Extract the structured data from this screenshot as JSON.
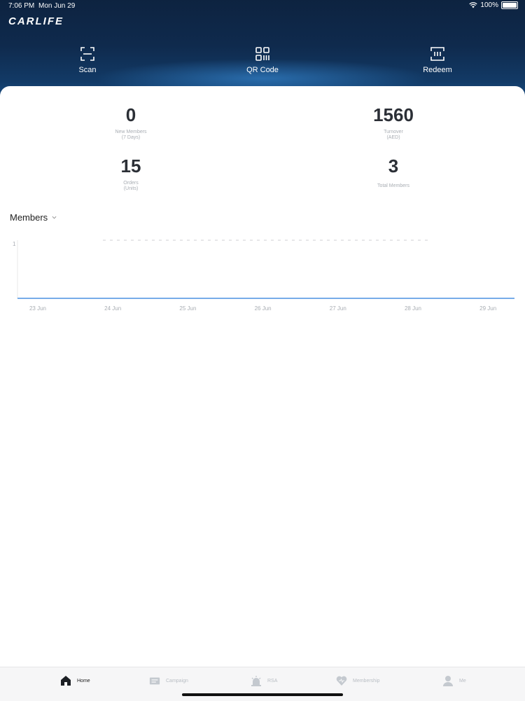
{
  "status_bar": {
    "time": "7:06 PM",
    "date": "Mon Jun 29",
    "battery": "100%"
  },
  "app": {
    "logo": "CARLIFE"
  },
  "actions": [
    {
      "label": "Scan",
      "icon": "scan-icon"
    },
    {
      "label": "QR Code",
      "icon": "qr-code-icon"
    },
    {
      "label": "Redeem",
      "icon": "redeem-icon"
    }
  ],
  "stats": {
    "new_members": {
      "value": "0",
      "label1": "New Members",
      "label2": "(7 Days)"
    },
    "turnover": {
      "value": "1560",
      "label1": "Turnover",
      "label2": "(AED)"
    },
    "orders": {
      "value": "15",
      "label1": "Orders",
      "label2": "(Units)"
    },
    "total_members": {
      "value": "3",
      "label1": "Total Members"
    }
  },
  "chart_selector": {
    "label": "Members"
  },
  "chart_data": {
    "type": "line",
    "categories": [
      "23 Jun",
      "24 Jun",
      "25 Jun",
      "26 Jun",
      "27 Jun",
      "28 Jun",
      "29 Jun"
    ],
    "series": [
      {
        "values": [
          0,
          0,
          0,
          0,
          0,
          0,
          0
        ]
      }
    ],
    "y_tick": "1",
    "ylim": [
      0,
      1
    ],
    "line_color": "#4a90e2"
  },
  "tabs": [
    {
      "label": "Home",
      "icon": "home-icon",
      "active": true
    },
    {
      "label": "Campaign",
      "icon": "campaign-icon",
      "active": false
    },
    {
      "label": "RSA",
      "icon": "rsa-icon",
      "active": false
    },
    {
      "label": "Membership",
      "icon": "membership-icon",
      "active": false
    },
    {
      "label": "Me",
      "icon": "profile-icon",
      "active": false
    }
  ],
  "colors": {
    "header_dark": "#0d2340",
    "header_glow": "#1a4f86",
    "accent": "#4a90e2"
  }
}
